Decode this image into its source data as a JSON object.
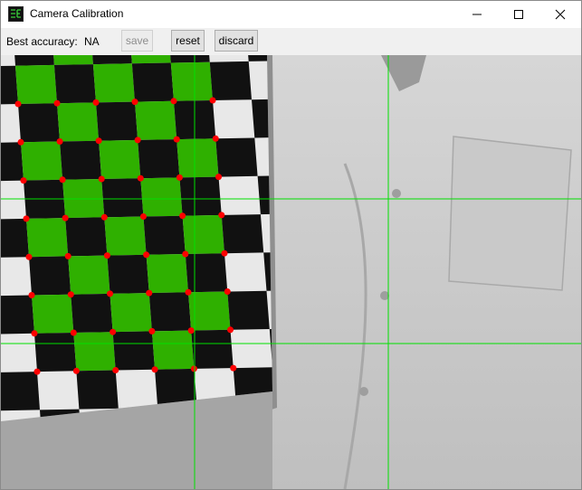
{
  "window": {
    "title": "Camera Calibration",
    "app_icon": "calibration-app-icon",
    "controls": {
      "minimize_icon": "minimize-icon",
      "maximize_icon": "maximize-icon",
      "close_icon": "close-icon"
    }
  },
  "toolbar": {
    "accuracy_label": "Best accuracy:",
    "accuracy_value": "NA",
    "save_label": "save",
    "save_enabled": false,
    "reset_label": "reset",
    "discard_label": "discard"
  },
  "camera_view": {
    "content": "live camera feed showing a checkerboard calibration target with detected corners",
    "corner_marker_color": "#ff0000",
    "guide_line_color": "#00e000",
    "highlight_color": "#2fb000"
  }
}
